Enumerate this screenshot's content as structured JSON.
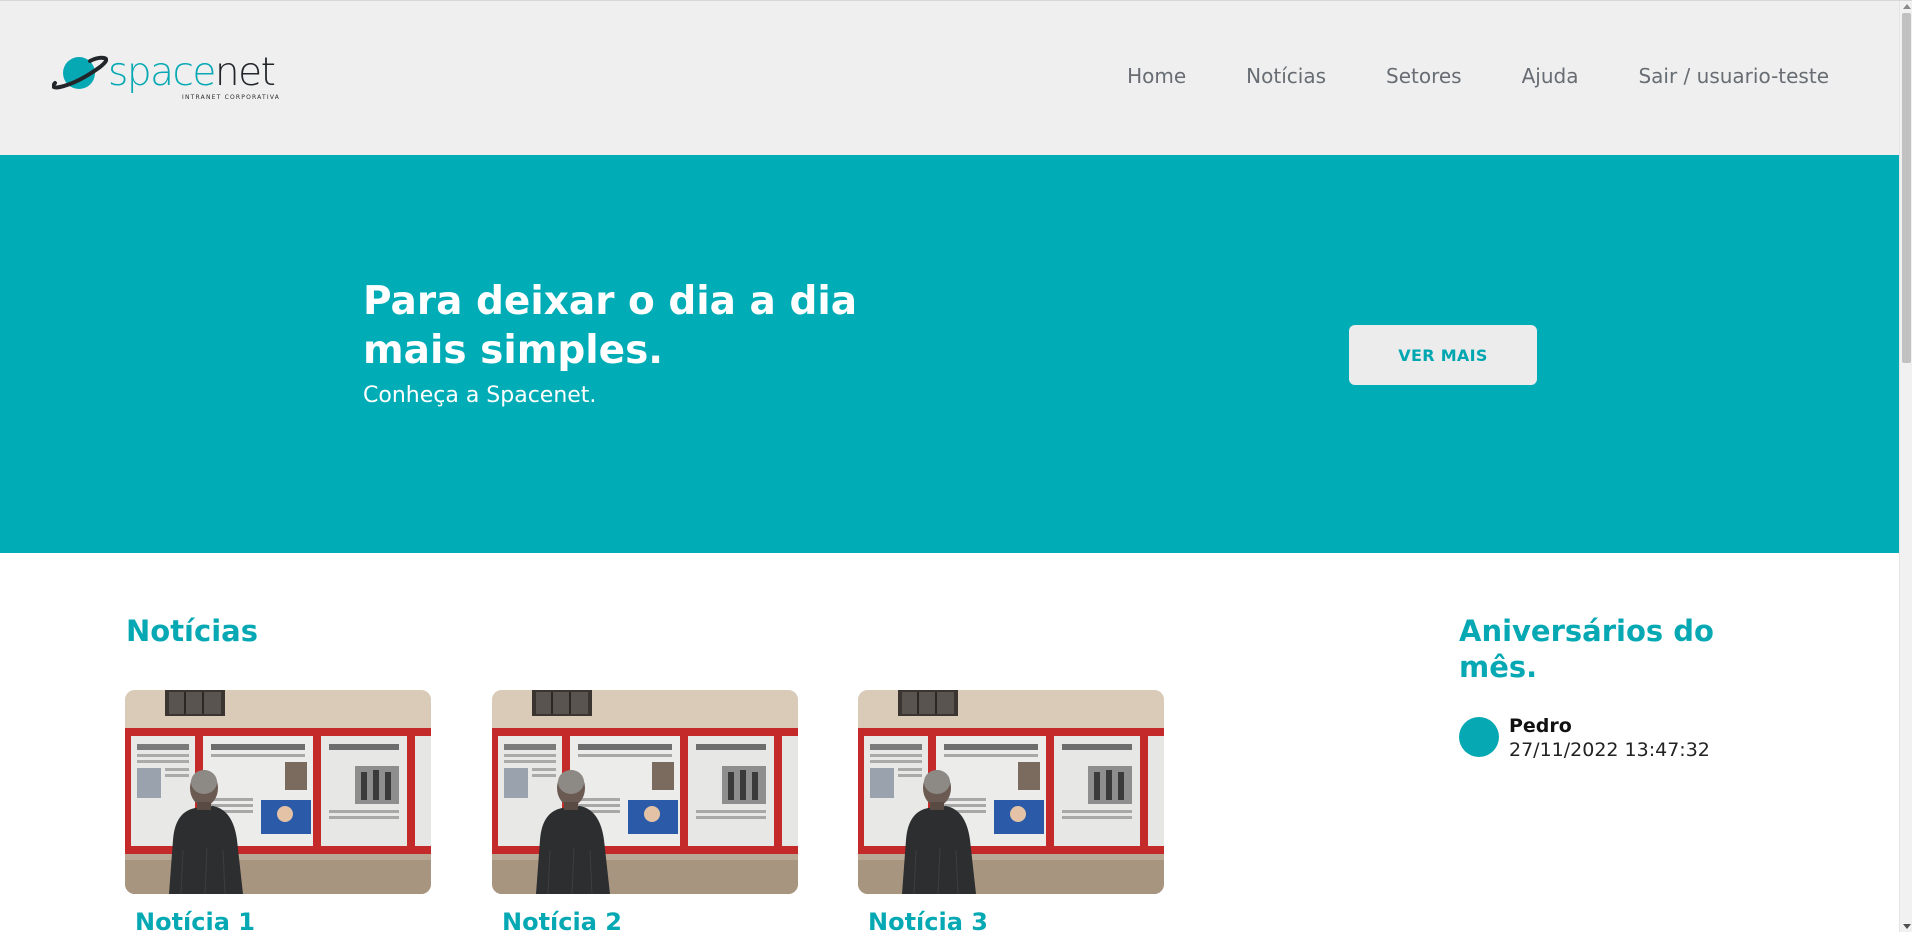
{
  "brand": {
    "name_part1": "space",
    "name_part2": "net",
    "tagline": "INTRANET CORPORATIVA",
    "accent_color": "#00acb6",
    "dark_color": "#22262b"
  },
  "nav": {
    "items": [
      {
        "label": "Home"
      },
      {
        "label": "Notícias"
      },
      {
        "label": "Setores"
      },
      {
        "label": "Ajuda"
      },
      {
        "label": "Sair / usuario-teste"
      }
    ]
  },
  "hero": {
    "title": "Para deixar o dia a dia mais simples.",
    "subtitle": "Conheça a Spacenet.",
    "button_label": "VER MAIS",
    "background_color": "#00acb6"
  },
  "news": {
    "title": "Notícias",
    "items": [
      {
        "title": "Notícia 1"
      },
      {
        "title": "Notícia 2"
      },
      {
        "title": "Notícia 3"
      }
    ]
  },
  "birthdays": {
    "title": "Aniversários do mês.",
    "items": [
      {
        "name": "Pedro",
        "date": "27/11/2022 13:47:32"
      }
    ]
  }
}
